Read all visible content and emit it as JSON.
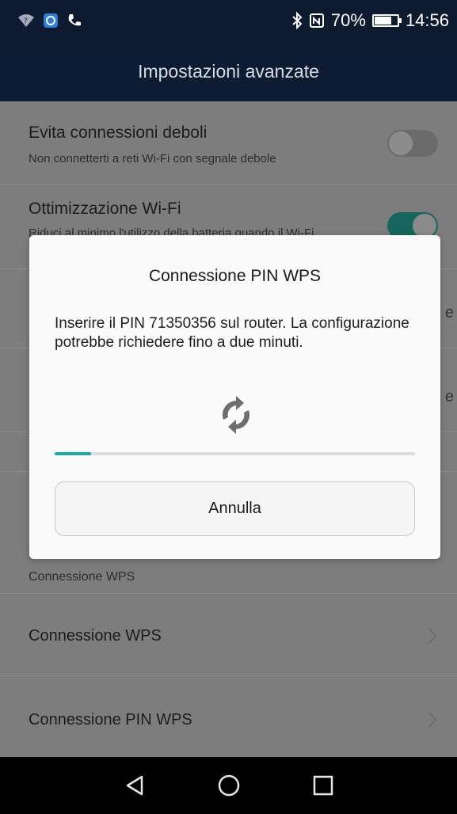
{
  "status_bar": {
    "battery_percent": "70%",
    "time": "14:56",
    "icons": [
      "wifi-question-icon",
      "app-notification-icon",
      "phone-call-icon",
      "bluetooth-icon",
      "nfc-icon",
      "battery-icon"
    ]
  },
  "title_bar": {
    "title": "Impostazioni avanzate"
  },
  "settings": {
    "weak_conn": {
      "title": "Evita connessioni deboli",
      "subtitle": "Non connetterti a reti Wi-Fi con segnale debole",
      "enabled": false
    },
    "wifi_opt": {
      "title": "Ottimizzazione Wi-Fi",
      "subtitle": "Riduci al minimo l'utilizzo della batteria quando il Wi-Fi",
      "enabled": true
    },
    "row3_edge": "e",
    "row4_edge": "e",
    "wps_header": "Connessione WPS",
    "wps": {
      "title": "Connessione WPS"
    },
    "wps_pin": {
      "title": "Connessione PIN WPS"
    }
  },
  "dialog": {
    "title": "Connessione PIN WPS",
    "message": "Inserire il PIN 71350356 sul router. La configurazione potrebbe richiedere fino a due minuti.",
    "progress": 0.1,
    "cancel_label": "Annulla"
  },
  "nav_bar": {
    "buttons": [
      "back-icon",
      "home-icon",
      "recents-icon"
    ]
  },
  "colors": {
    "accent": "#1aa8a8",
    "toggle_on": "#17665e",
    "title_bg": "#0e1c33"
  }
}
